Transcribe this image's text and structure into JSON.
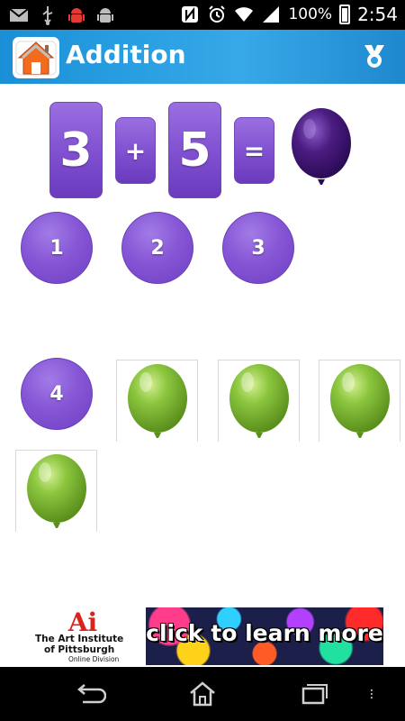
{
  "status_bar": {
    "battery_percent": "100%",
    "time": "2:54",
    "left_icons": [
      "email-icon",
      "usb-icon",
      "android-debug-icon",
      "android-icon"
    ],
    "right_icons": [
      "nfc-icon",
      "alarm-icon",
      "wifi-icon",
      "signal-icon",
      "battery-icon"
    ]
  },
  "action_bar": {
    "title": "Addition",
    "home_icon": "home-icon",
    "award_icon": "award-icon",
    "colors": {
      "gradient_start": "#1b8fd6",
      "gradient_end": "#1f88cf"
    }
  },
  "equation": {
    "operand1": "3",
    "plus": "+",
    "operand2": "5",
    "equals": "=",
    "result_icon": "purple-balloon-icon",
    "colors": {
      "tile": "#8656d6",
      "balloon": "#4a1c80"
    }
  },
  "answers": [
    "1",
    "2",
    "3",
    "4"
  ],
  "balloon_cards": {
    "count": 4,
    "icon": "green-balloon-icon",
    "color": "#8cc63f"
  },
  "ad": {
    "brand_line1": "The Art Institute",
    "brand_line2": "of Pittsburgh",
    "brand_line3": "Online Division",
    "logo_text": "Ai",
    "banner_text": "click to learn more"
  },
  "nav_bar": {
    "buttons": [
      "back-icon",
      "home-nav-icon",
      "recent-apps-icon",
      "overflow-menu-icon"
    ]
  }
}
